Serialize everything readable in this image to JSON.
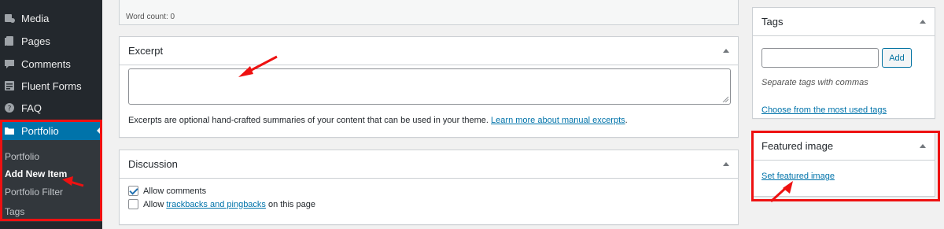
{
  "sidebar": {
    "items": [
      {
        "label": "Media",
        "icon": "media-icon"
      },
      {
        "label": "Pages",
        "icon": "pages-icon"
      },
      {
        "label": "Comments",
        "icon": "comments-icon"
      },
      {
        "label": "Fluent Forms",
        "icon": "forms-icon"
      },
      {
        "label": "FAQ",
        "icon": "faq-icon"
      },
      {
        "label": "Portfolio",
        "icon": "folder-icon"
      }
    ],
    "submenu": [
      "Portfolio",
      "Add New Item",
      "Portfolio Filter",
      "Tags"
    ]
  },
  "editor": {
    "word_count": "Word count: 0"
  },
  "excerpt": {
    "title": "Excerpt",
    "help_text": "Excerpts are optional hand-crafted summaries of your content that can be used in your theme.",
    "help_link": "Learn more about manual excerpts",
    "help_end": "."
  },
  "discussion": {
    "title": "Discussion",
    "allow_comments": "Allow comments",
    "allow_prefix": "Allow",
    "trackbacks_link": "trackbacks and pingbacks",
    "allow_suffix": "on this page"
  },
  "tags": {
    "title": "Tags",
    "add_button": "Add",
    "hint": "Separate tags with commas",
    "choose_link": "Choose from the most used tags"
  },
  "featured_image": {
    "title": "Featured image",
    "set_link": "Set featured image"
  },
  "colors": {
    "sidebar_bg": "#23282d",
    "active_menu": "#0073aa",
    "annotation_red": "#ee1111",
    "link": "#0073aa"
  }
}
